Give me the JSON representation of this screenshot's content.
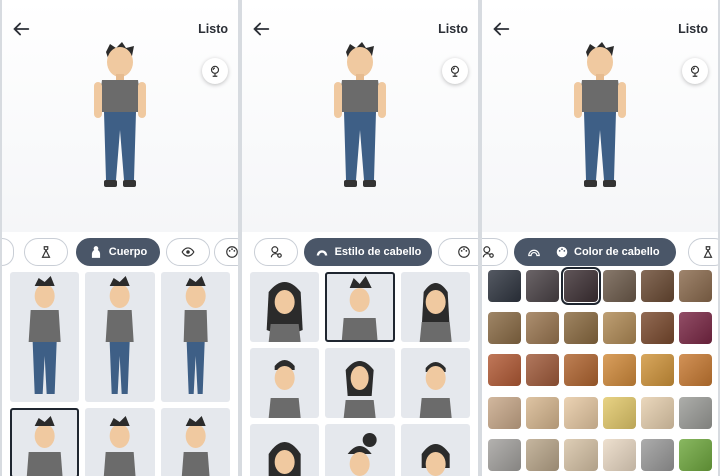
{
  "header": {
    "done_label": "Listo"
  },
  "panels": [
    {
      "tab_label": "Cuerpo",
      "tab_icons": [
        "hanger-icon",
        "body-icon",
        "eye-icon",
        "palette-icon"
      ]
    },
    {
      "tab_label": "Estilo de cabello",
      "tab_icons": [
        "person-icon",
        "hair-icon",
        "palette-icon"
      ]
    },
    {
      "tab_label": "Color de cabello",
      "tab_icons": [
        "person-icon",
        "hair-icon",
        "palette-icon",
        "hanger-icon"
      ]
    }
  ],
  "hair_colors": [
    "#2f3540",
    "#4a4246",
    "#3d3034",
    "#6d5b4b",
    "#6a4a33",
    "#8a6a4d",
    "#8a6b45",
    "#9a7650",
    "#8a6a40",
    "#b08a55",
    "#7a4a2e",
    "#7a2745",
    "#b25a35",
    "#a05a3a",
    "#b0642f",
    "#d18a3a",
    "#d0943a",
    "#c87a32",
    "#c8a889",
    "#d7b78f",
    "#e7c9a3",
    "#e3c96a",
    "#e6cfae",
    "#9b9c98",
    "#a3a19e",
    "#b9a68a",
    "#d7c3a6",
    "#ead9c4",
    "#9a9a9a",
    "#6fa83e"
  ],
  "selected_color_index": 2
}
